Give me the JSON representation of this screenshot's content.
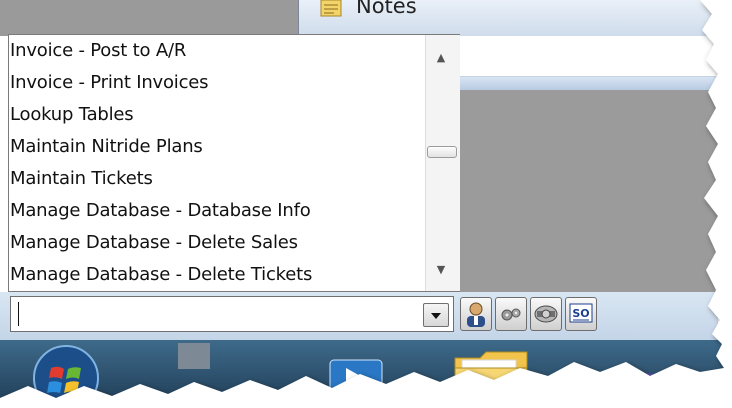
{
  "tab": {
    "notes_label": "Notes"
  },
  "list": {
    "items": [
      "Invoice - Post to A/R",
      "Invoice - Print Invoices",
      "Lookup Tables",
      "Maintain Nitride Plans",
      "Maintain Tickets",
      "Manage Database - Database Info",
      "Manage Database - Delete Sales",
      "Manage Database - Delete Tickets"
    ]
  },
  "combo": {
    "value": ""
  },
  "toolbar": {
    "icons": [
      "person-icon",
      "gears-icon",
      "camera-icon",
      "so-icon"
    ],
    "so_label": "SO"
  },
  "taskbar": {
    "icons": [
      "start-orb-icon",
      "remote-desktop-icon",
      "folder-icon",
      "browser-icon"
    ]
  }
}
